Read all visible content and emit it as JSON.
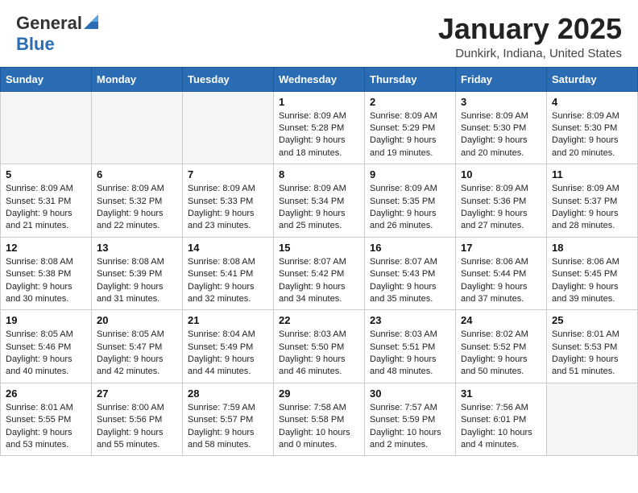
{
  "header": {
    "logo_general": "General",
    "logo_blue": "Blue",
    "month_title": "January 2025",
    "location": "Dunkirk, Indiana, United States"
  },
  "weekdays": [
    "Sunday",
    "Monday",
    "Tuesday",
    "Wednesday",
    "Thursday",
    "Friday",
    "Saturday"
  ],
  "weeks": [
    [
      {
        "day": "",
        "info": ""
      },
      {
        "day": "",
        "info": ""
      },
      {
        "day": "",
        "info": ""
      },
      {
        "day": "1",
        "info": "Sunrise: 8:09 AM\nSunset: 5:28 PM\nDaylight: 9 hours\nand 18 minutes."
      },
      {
        "day": "2",
        "info": "Sunrise: 8:09 AM\nSunset: 5:29 PM\nDaylight: 9 hours\nand 19 minutes."
      },
      {
        "day": "3",
        "info": "Sunrise: 8:09 AM\nSunset: 5:30 PM\nDaylight: 9 hours\nand 20 minutes."
      },
      {
        "day": "4",
        "info": "Sunrise: 8:09 AM\nSunset: 5:30 PM\nDaylight: 9 hours\nand 20 minutes."
      }
    ],
    [
      {
        "day": "5",
        "info": "Sunrise: 8:09 AM\nSunset: 5:31 PM\nDaylight: 9 hours\nand 21 minutes."
      },
      {
        "day": "6",
        "info": "Sunrise: 8:09 AM\nSunset: 5:32 PM\nDaylight: 9 hours\nand 22 minutes."
      },
      {
        "day": "7",
        "info": "Sunrise: 8:09 AM\nSunset: 5:33 PM\nDaylight: 9 hours\nand 23 minutes."
      },
      {
        "day": "8",
        "info": "Sunrise: 8:09 AM\nSunset: 5:34 PM\nDaylight: 9 hours\nand 25 minutes."
      },
      {
        "day": "9",
        "info": "Sunrise: 8:09 AM\nSunset: 5:35 PM\nDaylight: 9 hours\nand 26 minutes."
      },
      {
        "day": "10",
        "info": "Sunrise: 8:09 AM\nSunset: 5:36 PM\nDaylight: 9 hours\nand 27 minutes."
      },
      {
        "day": "11",
        "info": "Sunrise: 8:09 AM\nSunset: 5:37 PM\nDaylight: 9 hours\nand 28 minutes."
      }
    ],
    [
      {
        "day": "12",
        "info": "Sunrise: 8:08 AM\nSunset: 5:38 PM\nDaylight: 9 hours\nand 30 minutes."
      },
      {
        "day": "13",
        "info": "Sunrise: 8:08 AM\nSunset: 5:39 PM\nDaylight: 9 hours\nand 31 minutes."
      },
      {
        "day": "14",
        "info": "Sunrise: 8:08 AM\nSunset: 5:41 PM\nDaylight: 9 hours\nand 32 minutes."
      },
      {
        "day": "15",
        "info": "Sunrise: 8:07 AM\nSunset: 5:42 PM\nDaylight: 9 hours\nand 34 minutes."
      },
      {
        "day": "16",
        "info": "Sunrise: 8:07 AM\nSunset: 5:43 PM\nDaylight: 9 hours\nand 35 minutes."
      },
      {
        "day": "17",
        "info": "Sunrise: 8:06 AM\nSunset: 5:44 PM\nDaylight: 9 hours\nand 37 minutes."
      },
      {
        "day": "18",
        "info": "Sunrise: 8:06 AM\nSunset: 5:45 PM\nDaylight: 9 hours\nand 39 minutes."
      }
    ],
    [
      {
        "day": "19",
        "info": "Sunrise: 8:05 AM\nSunset: 5:46 PM\nDaylight: 9 hours\nand 40 minutes."
      },
      {
        "day": "20",
        "info": "Sunrise: 8:05 AM\nSunset: 5:47 PM\nDaylight: 9 hours\nand 42 minutes."
      },
      {
        "day": "21",
        "info": "Sunrise: 8:04 AM\nSunset: 5:49 PM\nDaylight: 9 hours\nand 44 minutes."
      },
      {
        "day": "22",
        "info": "Sunrise: 8:03 AM\nSunset: 5:50 PM\nDaylight: 9 hours\nand 46 minutes."
      },
      {
        "day": "23",
        "info": "Sunrise: 8:03 AM\nSunset: 5:51 PM\nDaylight: 9 hours\nand 48 minutes."
      },
      {
        "day": "24",
        "info": "Sunrise: 8:02 AM\nSunset: 5:52 PM\nDaylight: 9 hours\nand 50 minutes."
      },
      {
        "day": "25",
        "info": "Sunrise: 8:01 AM\nSunset: 5:53 PM\nDaylight: 9 hours\nand 51 minutes."
      }
    ],
    [
      {
        "day": "26",
        "info": "Sunrise: 8:01 AM\nSunset: 5:55 PM\nDaylight: 9 hours\nand 53 minutes."
      },
      {
        "day": "27",
        "info": "Sunrise: 8:00 AM\nSunset: 5:56 PM\nDaylight: 9 hours\nand 55 minutes."
      },
      {
        "day": "28",
        "info": "Sunrise: 7:59 AM\nSunset: 5:57 PM\nDaylight: 9 hours\nand 58 minutes."
      },
      {
        "day": "29",
        "info": "Sunrise: 7:58 AM\nSunset: 5:58 PM\nDaylight: 10 hours\nand 0 minutes."
      },
      {
        "day": "30",
        "info": "Sunrise: 7:57 AM\nSunset: 5:59 PM\nDaylight: 10 hours\nand 2 minutes."
      },
      {
        "day": "31",
        "info": "Sunrise: 7:56 AM\nSunset: 6:01 PM\nDaylight: 10 hours\nand 4 minutes."
      },
      {
        "day": "",
        "info": ""
      }
    ]
  ]
}
